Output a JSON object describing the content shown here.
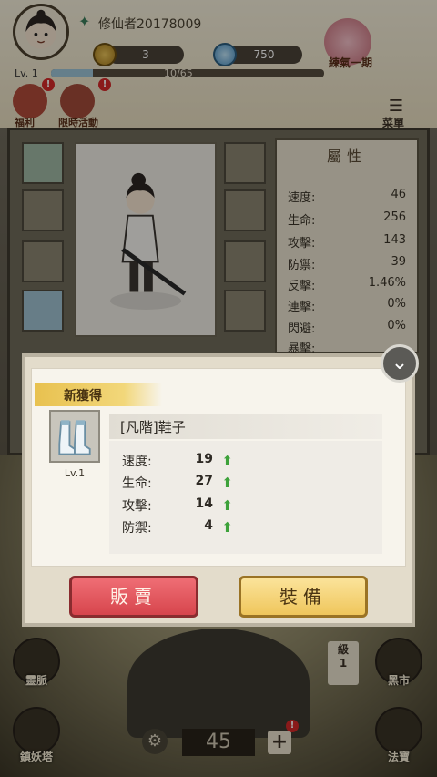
{
  "header": {
    "username": "修仙者20178009",
    "coins": "3",
    "gems": "750",
    "cultivate_label": "練氣一期",
    "level_label": "Lv. 1",
    "exp_text": "10/65",
    "exp_fraction": 0.154
  },
  "top_buttons": {
    "welfare_label": "福利",
    "limited_label": "限時活動",
    "badge": "!",
    "menu_label": "菜單"
  },
  "attributes": {
    "title": "屬性",
    "rows": [
      {
        "label": "速度:",
        "value": "46"
      },
      {
        "label": "生命:",
        "value": "256"
      },
      {
        "label": "攻擊:",
        "value": "143"
      },
      {
        "label": "防禦:",
        "value": "39"
      },
      {
        "label": "反擊:",
        "value": "1.46%"
      },
      {
        "label": "連擊:",
        "value": "0%"
      },
      {
        "label": "閃避:",
        "value": "0%"
      },
      {
        "label": "暴擊:",
        "value": ""
      }
    ]
  },
  "side_buttons": {
    "spirit_vein": "靈脈",
    "demon_tower": "鎮妖塔",
    "black_market": "黑市",
    "treasure": "法寶"
  },
  "bottom": {
    "count": "45",
    "plus": "+",
    "level_char": "級",
    "level_num": "1"
  },
  "modal": {
    "ribbon": "新獲得",
    "item_name": "[凡階]鞋子",
    "item_level": "Lv.1",
    "stats": [
      {
        "label": "速度:",
        "value": "19"
      },
      {
        "label": "生命:",
        "value": "27"
      },
      {
        "label": "攻擊:",
        "value": "14"
      },
      {
        "label": "防禦:",
        "value": "4"
      }
    ],
    "sell_label": "販賣",
    "equip_label": "裝備"
  }
}
